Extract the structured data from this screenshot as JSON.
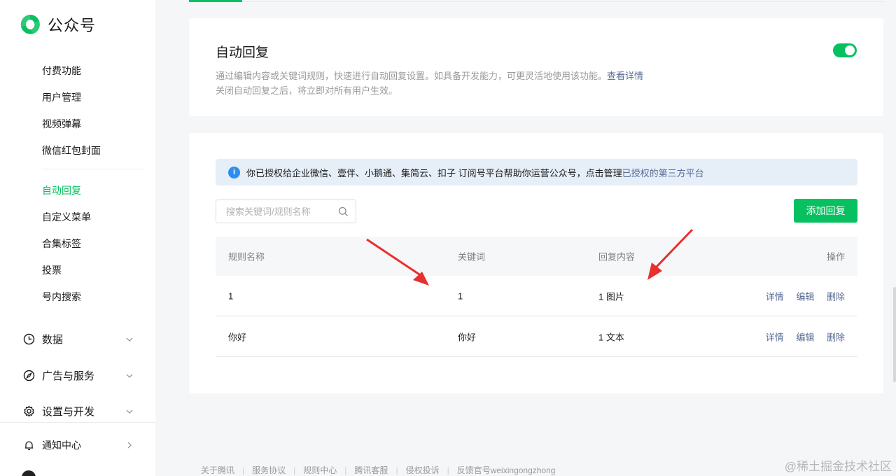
{
  "app": {
    "name": "公众号"
  },
  "sidebar": {
    "sub_items": [
      {
        "label": "付费功能"
      },
      {
        "label": "用户管理"
      },
      {
        "label": "视频弹幕"
      },
      {
        "label": "微信红包封面"
      },
      {
        "label": "自动回复",
        "active": true
      },
      {
        "label": "自定义菜单"
      },
      {
        "label": "合集标签"
      },
      {
        "label": "投票"
      },
      {
        "label": "号内搜索"
      }
    ],
    "groups": [
      {
        "label": "数据",
        "icon": "clock-icon"
      },
      {
        "label": "广告与服务",
        "icon": "compass-icon"
      },
      {
        "label": "设置与开发",
        "icon": "gear-icon"
      }
    ],
    "notify": {
      "label": "通知中心",
      "icon": "bell-icon"
    }
  },
  "auto_reply": {
    "title": "自动回复",
    "desc_line1": "通过编辑内容或关键词规则，快速进行自动回复设置。如具备开发能力，可更灵活地使用该功能。",
    "details_link": "查看详情",
    "desc_line2": "关闭自动回复之后，将立即对所有用户生效。",
    "enabled": true
  },
  "notice": {
    "icon_glyph": "i",
    "text": "你已授权给企业微信、壹伴、小鹅通、集简云、扣子 订阅号平台帮助你运营公众号，点击管理",
    "link": "已授权的第三方平台"
  },
  "search": {
    "placeholder": "搜索关键词/规则名称",
    "value": ""
  },
  "add_button": "添加回复",
  "table": {
    "headers": [
      "规则名称",
      "关键词",
      "回复内容",
      "操作"
    ],
    "rows": [
      {
        "name": "1",
        "keyword": "1",
        "content": "1 图片",
        "ops": [
          "详情",
          "编辑",
          "删除"
        ]
      },
      {
        "name": "你好",
        "keyword": "你好",
        "content": "1 文本",
        "ops": [
          "详情",
          "编辑",
          "删除"
        ]
      }
    ]
  },
  "footer": [
    "关于腾讯",
    "服务协议",
    "规则中心",
    "腾讯客服",
    "侵权投诉",
    "反馈官号weixingongzhong"
  ],
  "watermark": "@稀土掘金技术社区",
  "colors": {
    "accent": "#07c160",
    "link": "#576b95",
    "info": "#2f8cf0",
    "annotation_arrow": "#e8302c"
  }
}
